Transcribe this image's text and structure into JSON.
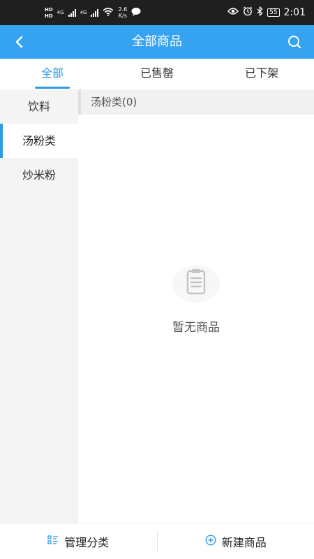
{
  "status_bar": {
    "hd_top": "HD",
    "hd_bottom": "HD",
    "net1": "4G",
    "net2": "4G",
    "speed_value": "2.6",
    "speed_unit": "K/s",
    "battery": "55",
    "time": "2:01",
    "icons": [
      "wifi-icon",
      "chat-icon",
      "eye-icon",
      "alarm-icon",
      "bluetooth-icon"
    ]
  },
  "header": {
    "title": "全部商品",
    "back_icon": "chevron-left-icon",
    "search_icon": "search-icon"
  },
  "tabs": [
    {
      "label": "全部",
      "active": true
    },
    {
      "label": "已售罄",
      "active": false
    },
    {
      "label": "已下架",
      "active": false
    }
  ],
  "sidebar": {
    "items": [
      {
        "label": "饮料",
        "active": false
      },
      {
        "label": "汤粉类",
        "active": true
      },
      {
        "label": "炒米粉",
        "active": false
      }
    ]
  },
  "content": {
    "category_header": "汤粉类(0)",
    "empty_text": "暂无商品",
    "empty_icon": "clipboard-icon"
  },
  "bottom_bar": {
    "manage_label": "管理分类",
    "new_label": "新建商品"
  },
  "colors": {
    "accent": "#36a3f0",
    "active_text": "#2f9be8"
  }
}
